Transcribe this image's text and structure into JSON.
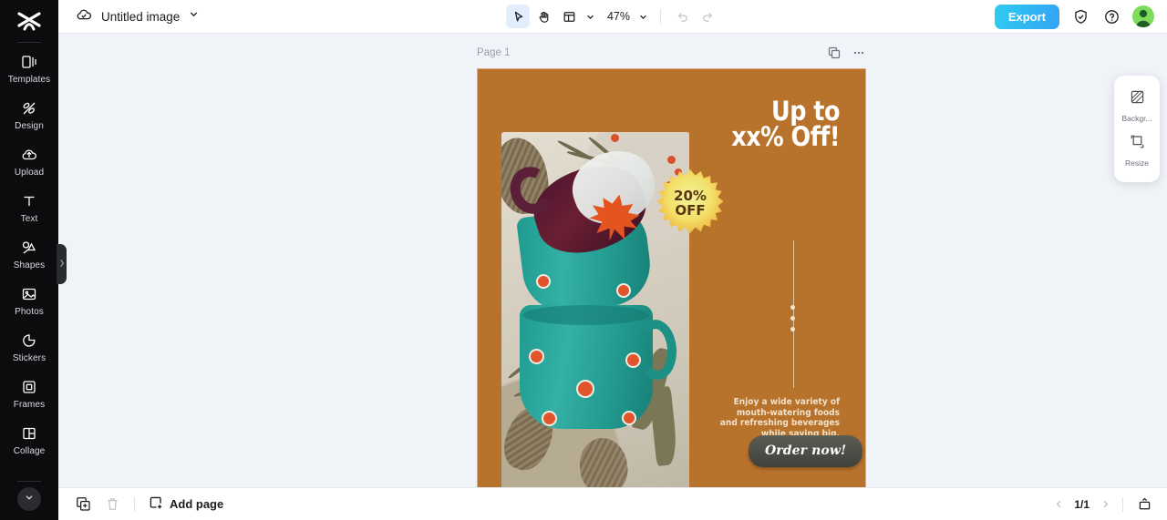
{
  "sidebar": {
    "logo_icon": "capcut-logo-icon",
    "items": [
      {
        "label": "Templates",
        "icon": "templates-icon"
      },
      {
        "label": "Design",
        "icon": "design-icon"
      },
      {
        "label": "Upload",
        "icon": "upload-cloud-icon"
      },
      {
        "label": "Text",
        "icon": "text-icon"
      },
      {
        "label": "Shapes",
        "icon": "shapes-icon"
      },
      {
        "label": "Photos",
        "icon": "photos-icon"
      },
      {
        "label": "Stickers",
        "icon": "stickers-icon"
      },
      {
        "label": "Frames",
        "icon": "frames-icon"
      },
      {
        "label": "Collage",
        "icon": "collage-icon"
      }
    ],
    "expand_more_icon": "chevron-down-icon",
    "edge_handle_icon": "chevron-right-icon"
  },
  "topbar": {
    "cloud_icon": "cloud-check-icon",
    "doc_title": "Untitled image",
    "title_caret_icon": "chevron-down-icon",
    "tools": [
      {
        "name": "select-tool",
        "icon": "cursor-arrow-icon",
        "selected": true
      },
      {
        "name": "hand-tool",
        "icon": "hand-icon",
        "selected": false
      }
    ],
    "layout_icon": "layout-panel-icon",
    "layout_caret_icon": "chevron-down-icon",
    "zoom_level": "47%",
    "zoom_caret_icon": "chevron-down-icon",
    "undo_icon": "undo-arrow-icon",
    "redo_icon": "redo-arrow-icon",
    "export_label": "Export",
    "export_color": "#33a3f5",
    "shield_icon": "shield-check-icon",
    "help_icon": "question-circle-icon",
    "avatar_label": "user-avatar",
    "avatar_color": "#7ddc5c"
  },
  "workspace": {
    "page_label": "Page 1",
    "duplicate_icon": "duplicate-page-icon",
    "more_icon": "ellipsis-horizontal-icon",
    "canvas_background": "#b7722b"
  },
  "design": {
    "headline_line1": "Up to",
    "headline_line2": "xx% Off!",
    "badge_line1": "20%",
    "badge_line2": "OFF",
    "body_line1": "Enjoy a wide variety of",
    "body_line2": "mouth-watering foods",
    "body_line3": "and refreshing beverages",
    "body_line4": "while saving big.",
    "cta_label": "Order now!",
    "cta_color": "#46493f",
    "photo_alt": "teal polka-dot mugs with autumn leaf"
  },
  "right_panel": {
    "items": [
      {
        "label": "Backgr...",
        "icon": "background-pattern-icon"
      },
      {
        "label": "Resize",
        "icon": "resize-icon"
      }
    ]
  },
  "bottombar": {
    "duplicate_icon": "duplicate-icon",
    "delete_icon": "trash-icon",
    "add_page_icon": "plus-square-icon",
    "add_page_label": "Add page",
    "prev_icon": "chevron-left-icon",
    "page_counter": "1/1",
    "next_icon": "chevron-right-icon",
    "present_icon": "present-grid-icon"
  }
}
